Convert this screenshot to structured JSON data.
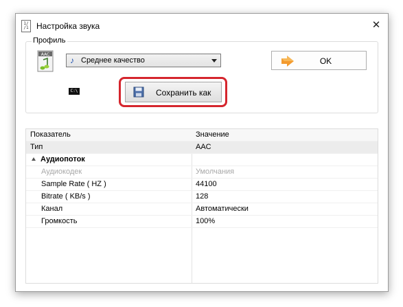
{
  "window": {
    "title": "Настройка звука",
    "close_glyph": "✕",
    "icon": "app-settings-icon"
  },
  "profile": {
    "group_label": "Профиль",
    "format_icon": "aac-file-icon",
    "selected": "Среднее качество",
    "select_icon": "music-note-icon",
    "ok_label": "OK",
    "ok_icon": "orange-arrow-icon",
    "cmd_icon_text": "C:\\",
    "save_label": "Сохранить как",
    "save_icon": "floppy-disk-icon",
    "highlight_color": "#d5252d"
  },
  "properties": {
    "headers": {
      "name": "Показатель",
      "value": "Значение"
    },
    "rows": [
      {
        "name": "Тип",
        "value": "AAC"
      },
      {
        "name": "Аудиопоток",
        "value": ""
      },
      {
        "name": "Аудиокодек",
        "value": "Умолчания"
      },
      {
        "name": "Sample Rate ( HZ )",
        "value": "44100"
      },
      {
        "name": "Bitrate ( KB/s )",
        "value": "128"
      },
      {
        "name": "Канал",
        "value": "Автоматически"
      },
      {
        "name": "Громкость",
        "value": "100%"
      }
    ]
  }
}
